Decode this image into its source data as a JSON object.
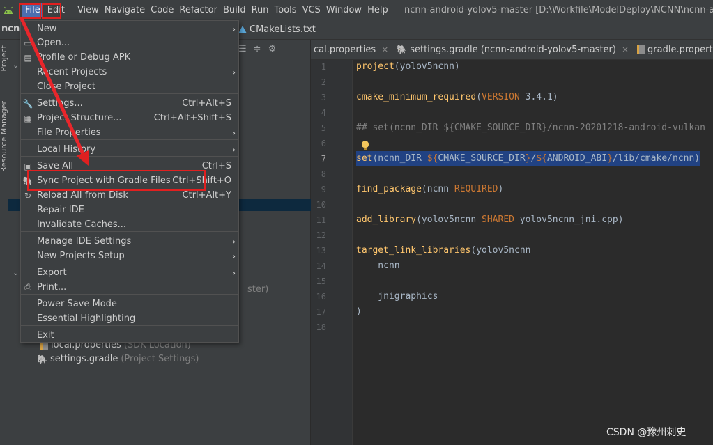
{
  "menubar": {
    "items": [
      "File",
      "Edit",
      "View",
      "Navigate",
      "Code",
      "Refactor",
      "Build",
      "Run",
      "Tools",
      "VCS",
      "Window",
      "Help"
    ],
    "window_title": "ncnn-android-yolov5-master [D:\\Workfile\\ModelDeploy\\NCNN\\ncnn-android-"
  },
  "navbar": {
    "crumb": "ncnn",
    "tab": "CMakeLists.txt"
  },
  "sidebar": {
    "project_label": "Project",
    "resource_label": "Resource Manager"
  },
  "file_menu": {
    "items": [
      {
        "label": "New",
        "shortcut": "",
        "submenu": true,
        "icon": ""
      },
      {
        "label": "Open...",
        "shortcut": "",
        "submenu": false,
        "icon": "folder-icon"
      },
      {
        "label": "Profile or Debug APK",
        "shortcut": "",
        "submenu": false,
        "icon": "apk-icon"
      },
      {
        "label": "Recent Projects",
        "shortcut": "",
        "submenu": true,
        "icon": ""
      },
      {
        "label": "Close Project",
        "shortcut": "",
        "submenu": false,
        "icon": ""
      },
      {
        "label": "Settings...",
        "shortcut": "Ctrl+Alt+S",
        "submenu": false,
        "icon": "wrench-icon"
      },
      {
        "label": "Project Structure...",
        "shortcut": "Ctrl+Alt+Shift+S",
        "submenu": false,
        "icon": "structure-icon"
      },
      {
        "label": "File Properties",
        "shortcut": "",
        "submenu": true,
        "icon": ""
      },
      {
        "label": "Local History",
        "shortcut": "",
        "submenu": true,
        "icon": ""
      },
      {
        "label": "Save All",
        "shortcut": "Ctrl+S",
        "submenu": false,
        "icon": "save-icon"
      },
      {
        "label": "Sync Project with Gradle Files",
        "shortcut": "Ctrl+Shift+O",
        "submenu": false,
        "icon": "gradle-sync-icon"
      },
      {
        "label": "Reload All from Disk",
        "shortcut": "Ctrl+Alt+Y",
        "submenu": false,
        "icon": "reload-icon"
      },
      {
        "label": "Repair IDE",
        "shortcut": "",
        "submenu": false,
        "icon": ""
      },
      {
        "label": "Invalidate Caches...",
        "shortcut": "",
        "submenu": false,
        "icon": ""
      },
      {
        "label": "Manage IDE Settings",
        "shortcut": "",
        "submenu": true,
        "icon": ""
      },
      {
        "label": "New Projects Setup",
        "shortcut": "",
        "submenu": true,
        "icon": ""
      },
      {
        "label": "Export",
        "shortcut": "",
        "submenu": true,
        "icon": ""
      },
      {
        "label": "Print...",
        "shortcut": "",
        "submenu": false,
        "icon": "printer-icon"
      },
      {
        "label": "Power Save Mode",
        "shortcut": "",
        "submenu": false,
        "icon": ""
      },
      {
        "label": "Essential Highlighting",
        "shortcut": "",
        "submenu": false,
        "icon": ""
      },
      {
        "label": "Exit",
        "shortcut": "",
        "submenu": false,
        "icon": ""
      }
    ]
  },
  "project_tree": {
    "partial_text": "ster)",
    "rows": [
      {
        "name": "local.properties",
        "meta": "(SDK Location)"
      },
      {
        "name": "settings.gradle",
        "meta": "(Project Settings)"
      }
    ]
  },
  "editor_tabs": [
    {
      "label": "cal.properties",
      "icon": ""
    },
    {
      "label": "settings.gradle (ncnn-android-yolov5-master)",
      "icon": "gradle-icon"
    },
    {
      "label": "gradle.properties",
      "icon": "properties-icon"
    }
  ],
  "editor": {
    "line_numbers": [
      "1",
      "2",
      "3",
      "4",
      "5",
      "6",
      "7",
      "8",
      "9",
      "10",
      "11",
      "12",
      "13",
      "14",
      "15",
      "16",
      "17",
      "18"
    ],
    "current_line": "7",
    "lines": {
      "l1": {
        "fn": "project",
        "rest": "(yolov5ncnn)"
      },
      "l3": {
        "fn": "cmake_minimum_required",
        "p1": "(",
        "kw": "VERSION",
        "rest": " 3.4.1)"
      },
      "l5": {
        "comment": "## set(ncnn_DIR ${CMAKE_SOURCE_DIR}/ncnn-20201218-android-vulkan"
      },
      "l7": {
        "fn": "set",
        "p1": "(ncnn_DIR ",
        "kw1": "${",
        "v1": "CMAKE_SOURCE_DIR",
        "kw2": "}",
        "p2": "/",
        "kw3": "${",
        "v2": "ANDROID_ABI",
        "kw4": "}",
        "p3": "/lib/cmake/ncnn)"
      },
      "l9": {
        "fn": "find_package",
        "p1": "(ncnn ",
        "kw": "REQUIRED",
        "rest": ")"
      },
      "l11": {
        "fn": "add_library",
        "p1": "(yolov5ncnn ",
        "kw": "SHARED",
        "rest": " yolov5ncnn_jni.cpp)"
      },
      "l13": {
        "fn": "target_link_libraries",
        "rest": "(yolov5ncnn"
      },
      "l14": {
        "text": "    ncnn"
      },
      "l16": {
        "text": "    jnigraphics"
      },
      "l17": {
        "text": ")"
      }
    }
  },
  "watermark": "CSDN @豫州刺史",
  "colors": {
    "annotation_red": "#e02020",
    "selection": "#214283",
    "menu_active": "#4b6eaf"
  }
}
